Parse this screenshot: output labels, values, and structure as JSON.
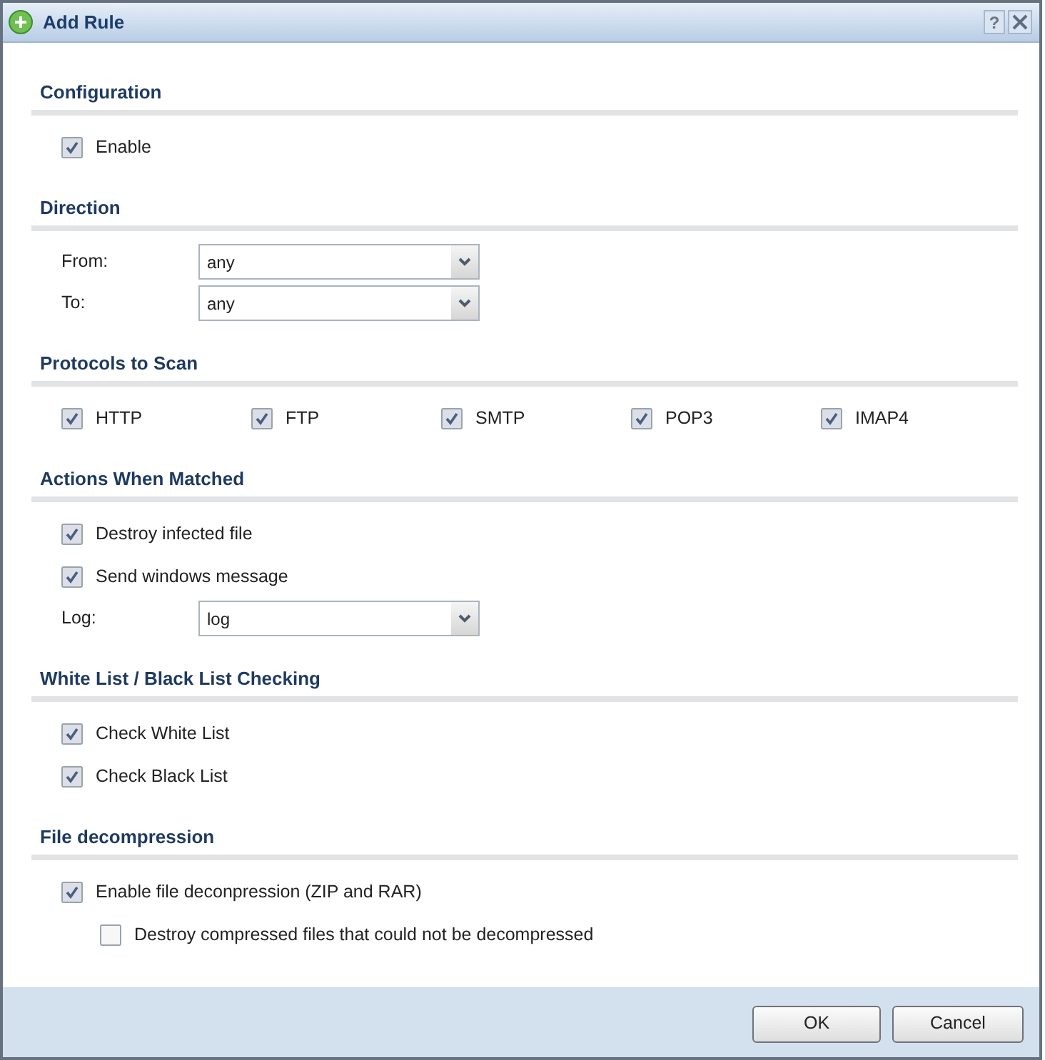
{
  "window": {
    "title": "Add Rule",
    "help_label": "?"
  },
  "sections": [
    {
      "heading": "Configuration",
      "rows": [
        {
          "kind": "checkbox",
          "label": "Enable",
          "checked": true
        }
      ]
    },
    {
      "heading": "Direction",
      "rows": [
        {
          "kind": "select",
          "label": "From:",
          "value": "any"
        },
        {
          "kind": "select",
          "label": "To:",
          "value": "any"
        }
      ]
    },
    {
      "heading": "Protocols to Scan",
      "rows": [
        {
          "kind": "checkbox_group",
          "items": [
            {
              "label": "HTTP",
              "checked": true
            },
            {
              "label": "FTP",
              "checked": true
            },
            {
              "label": "SMTP",
              "checked": true
            },
            {
              "label": "POP3",
              "checked": true
            },
            {
              "label": "IMAP4",
              "checked": true
            }
          ]
        }
      ]
    },
    {
      "heading": "Actions When Matched",
      "rows": [
        {
          "kind": "checkbox",
          "label": "Destroy infected file",
          "checked": true
        },
        {
          "kind": "checkbox",
          "label": "Send windows message",
          "checked": true
        },
        {
          "kind": "select",
          "label": "Log:",
          "value": "log"
        }
      ]
    },
    {
      "heading": "White List / Black List Checking",
      "rows": [
        {
          "kind": "checkbox",
          "label": "Check White List",
          "checked": true
        },
        {
          "kind": "checkbox",
          "label": "Check Black List",
          "checked": true
        }
      ]
    },
    {
      "heading": "File decompression",
      "rows": [
        {
          "kind": "checkbox",
          "label": "Enable file deconpression (ZIP and RAR)",
          "checked": true,
          "children": [
            {
              "kind": "checkbox",
              "label": "Destroy compressed files that could not be decompressed",
              "checked": false
            }
          ]
        }
      ]
    }
  ],
  "buttons": [
    {
      "kind": "ok",
      "label": "OK"
    },
    {
      "kind": "cancel",
      "label": "Cancel"
    }
  ]
}
